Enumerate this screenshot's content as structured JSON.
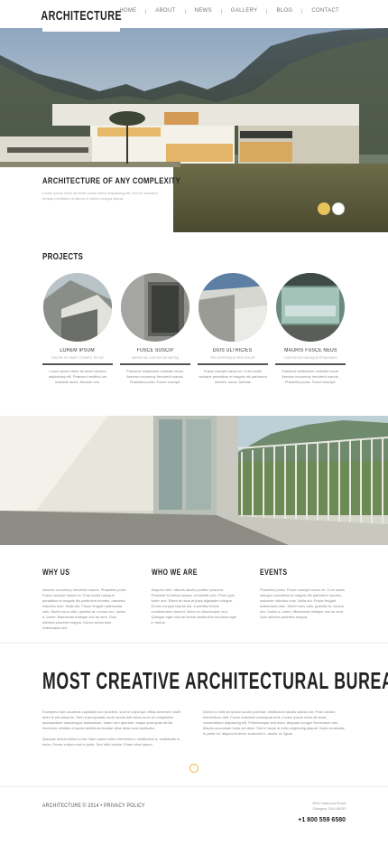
{
  "header": {
    "logo": "ARCHITECTURE",
    "nav": [
      "HOME",
      "ABOUT",
      "NEWS",
      "GALLERY",
      "BLOG",
      "CONTACT"
    ]
  },
  "hero": {
    "title": "ARCHITECTURE OF ANY COMPLEXITY",
    "text": "Lorem ipsum dolor sit amet conse ctetur adipisicing elit, sed do eiusmod tempor incididunt ut labore et dolore magna aliqua.",
    "slide_dots": 2,
    "active_dot_color": "#e7c35a"
  },
  "projects": {
    "title": "PROJECTS",
    "items": [
      {
        "name": "LOREM IPSUM",
        "sub": "DOLOR SIT AMET CONSEC TETUR",
        "desc": "Lorem ipsum dolor sit amet consect adipisicing elit. Praesent vestibul um molestie lacus. Aenean non."
      },
      {
        "name": "FUSCE SUSCIP",
        "sub": "VARIUS MI CUM SOCIIS NATOQ",
        "desc": "Praesent vestibulum molestie lacus. Aenean nonummy hendrerit mauris. Phasellus porta. Fusce suscipit."
      },
      {
        "name": "DUIS ULTRICIES",
        "sub": "PELLENTESQUE SED DOLOR",
        "desc": "Fusce suscipit varius mi. Cum sociis natoque penatibus et magnis dis parturient montes. lacus. Aenean"
      },
      {
        "name": "MAURIS FUSCE NEUS",
        "sub": "CUM SOCIIS NATOQUE PENATIBUS",
        "desc": "Praesent vestibulum molestie lacus. Aenean nonummy hendrerit mauris. Phasellus porta. Fusce suscipit."
      }
    ]
  },
  "columns": [
    {
      "title": "WHY US",
      "text": "Aenean nonummy hendrerit mauris. Phasellus porta. Fusce suscipit varius mi. Cum sociis natoque penatibus et magnis dis parturient montes, nascetur ridiculus mus. Nulla dui. Fusce feugiat malesuada odio. Morbi nunc odio, gravida at, cursus nec, luctus a, lorem. Maecenas tristique orci ac sem. Duis ultricies pharetra magna. Donec accumsan malesuada orci."
    },
    {
      "title": "WHO WE ARE",
      "text": "Aliquam nibh. Mauris iaculis porttitor posuere. Praesent id metus massa, ut blandit odio. Proin quis tortor orci. Etiam at risus et justo dignissim congue. Donec congue lacinia dui, a porttitor lectus condimentum laoreet. Nunc eu ullamcorper orci. Quisque eget odio ac lectus vestibulum faucibus eget in metus."
    },
    {
      "title": "EVENTS",
      "text": "Phasellus porta. Fusce suscipit varius mi. Cum sociis natoque penatibus et magnis dis parturient montes, nascetur ridiculus mus. Nulla dui. Fusce feugiat malesuada odio. Morbi nunc odio, gravida at, cursus nec, luctus a, lorem. Maecenas tristique orci ac sem. Duis ultricies pharetra magna."
    }
  ],
  "bureau": {
    "title": "MOST CREATIVE ARCHITECTURAL BUREAU",
    "left": [
      "Excepteur sint occaecat cupidatat non proident, sunt in culpa qui officia deserunt mollit anim id est laborum. Sed ut perspiciatis unde omnis iste natus error sit voluptatem accusantium doloremque laudantium, totam rem aperiam, eaque ipsa quae ab illo inventore veritatis et quasi architecto beatae vitae dicta sunt explicabo.",
      "Quisque dictum tellus id est. Nam varius tortor elementum, vestibulum a, sollicitudin in, tortor. Donec rutrum erat in justo. Sed nibh lacinia. Etiam vitae ipsum."
    ],
    "right": [
      "Donec in velit vel ipsum auctor pulvinar. Vestibulum iaculis lacinia est. Proin dictum elementum velit. Fusce euismod consequat ante. Lorem ipsum dolor sit amet, consectetuer adipiscing elit. Pellentesque sed dolor. Aliquam congue fermentum nisl. Mauris accumsan nulla vel diam. Sed in lacus ut enim adipiscing aliquet. Nulla venenatis. In pede mi, aliquet sit amet, euismod in, auctor ut, ligula."
    ],
    "scroll_icon": "↑"
  },
  "footer": {
    "left": "ARCHITECTURE © 2014 • PRIVACY POLICY",
    "address": [
      "8901 Marmora Road",
      "Glasgow, D04 89GR"
    ],
    "phone": "+1 800 559 6580"
  }
}
